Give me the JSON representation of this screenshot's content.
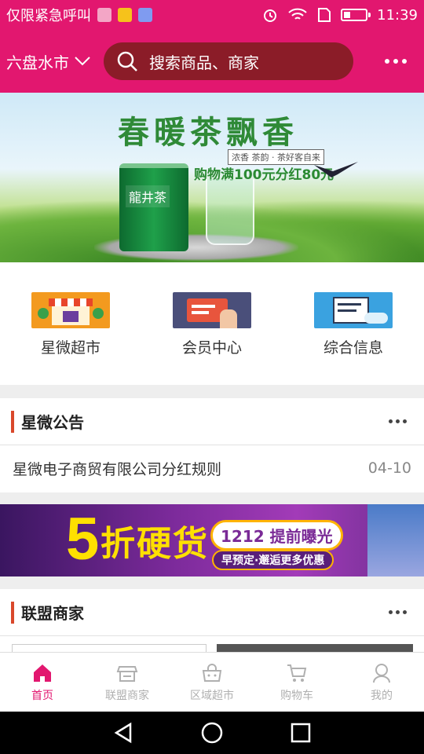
{
  "status_bar": {
    "carrier": "仅限紧急呼叫",
    "time": "11:39",
    "battery_level": 0.3,
    "icons": [
      "gallery-icon",
      "app-badge-icon",
      "shield-icon",
      "alarm-icon",
      "wifi-icon",
      "sim-icon",
      "battery-icon"
    ]
  },
  "header": {
    "city": "六盘水市",
    "search_placeholder": "搜索商品、商家"
  },
  "banner": {
    "title": "春暖茶飘香",
    "small_tag": "浓香 茶韵 · 茶好客自来",
    "promo": "购物满100元分红80元",
    "product_label": "龍井茶",
    "slide_count": 3,
    "active_slide": 2
  },
  "categories": [
    {
      "label": "星微超市",
      "icon": "shop-icon",
      "color": "#f39a1f"
    },
    {
      "label": "会员中心",
      "icon": "member-card-icon",
      "color": "#4a4f7a"
    },
    {
      "label": "综合信息",
      "icon": "info-book-icon",
      "color": "#3aa2e0"
    }
  ],
  "notice": {
    "title": "星微公告",
    "items": [
      {
        "text": "星微电子商贸有限公司分红规则",
        "date": "04-10"
      }
    ]
  },
  "ad": {
    "big_number": "5",
    "headline": "折硬货",
    "tag": "1212 提前曝光",
    "sub_tag": "早预定·邂逅更多优惠"
  },
  "merchants": {
    "title": "联盟商家"
  },
  "tabbar": [
    {
      "label": "首页",
      "icon": "home-icon",
      "active": true
    },
    {
      "label": "联盟商家",
      "icon": "store-icon",
      "active": false
    },
    {
      "label": "区域超市",
      "icon": "basket-icon",
      "active": false
    },
    {
      "label": "购物车",
      "icon": "cart-icon",
      "active": false
    },
    {
      "label": "我的",
      "icon": "user-icon",
      "active": false
    }
  ],
  "colors": {
    "brand": "#e2176f",
    "search_bg": "#8b1c28",
    "section_bar": "#d9482b"
  }
}
